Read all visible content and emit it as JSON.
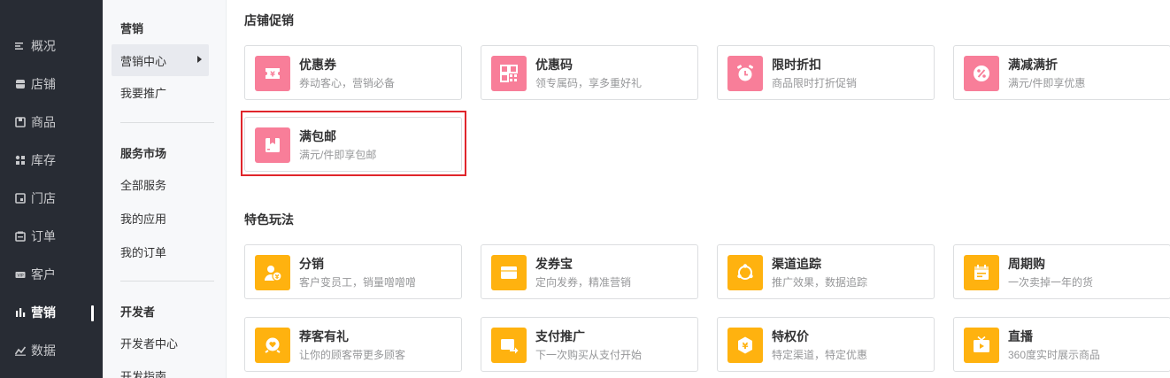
{
  "primary_nav": {
    "items": [
      {
        "label": "概况",
        "icon": "overview-icon"
      },
      {
        "label": "店铺",
        "icon": "store-icon"
      },
      {
        "label": "商品",
        "icon": "goods-icon"
      },
      {
        "label": "库存",
        "icon": "inventory-icon"
      },
      {
        "label": "门店",
        "icon": "shop-icon"
      },
      {
        "label": "订单",
        "icon": "order-icon"
      },
      {
        "label": "客户",
        "icon": "customer-icon"
      },
      {
        "label": "营销",
        "icon": "marketing-icon",
        "active": true
      },
      {
        "label": "数据",
        "icon": "data-icon"
      }
    ]
  },
  "sub_nav": {
    "groups": [
      {
        "title": "营销",
        "items": [
          {
            "label": "营销中心",
            "active": true
          },
          {
            "label": "我要推广"
          }
        ]
      },
      {
        "title": "服务市场",
        "items": [
          {
            "label": "全部服务"
          },
          {
            "label": "我的应用"
          },
          {
            "label": "我的订单"
          }
        ]
      },
      {
        "title": "开发者",
        "items": [
          {
            "label": "开发者中心"
          },
          {
            "label": "开发指南"
          }
        ]
      }
    ]
  },
  "sections": [
    {
      "title": "店铺促销",
      "cards": [
        {
          "title": "优惠券",
          "desc": "券动客心，营销必备",
          "icon": "coupon-icon",
          "color": "#f87e99"
        },
        {
          "title": "优惠码",
          "desc": "领专属码，享多重好礼",
          "icon": "qrcode-icon",
          "color": "#f87e99"
        },
        {
          "title": "限时折扣",
          "desc": "商品限时打折促销",
          "icon": "alarm-clock-icon",
          "color": "#f87e99"
        },
        {
          "title": "满减满折",
          "desc": "满元/件即享优惠",
          "icon": "percent-icon",
          "color": "#f87e99"
        },
        {
          "title": "满包邮",
          "desc": "满元/件即享包邮",
          "icon": "package-icon",
          "color": "#f87e99",
          "highlighted": true
        }
      ]
    },
    {
      "title": "特色玩法",
      "cards": [
        {
          "title": "分销",
          "desc": "客户变员工，销量噌噌噌",
          "icon": "distribution-icon",
          "color": "#ffb20f"
        },
        {
          "title": "发券宝",
          "desc": "定向发券，精准营销",
          "icon": "coupon-wallet-icon",
          "color": "#ffb20f"
        },
        {
          "title": "渠道追踪",
          "desc": "推广效果，数据追踪",
          "icon": "tracking-icon",
          "color": "#ffb20f"
        },
        {
          "title": "周期购",
          "desc": "一次卖掉一年的货",
          "icon": "calendar-icon",
          "color": "#ffb20f"
        },
        {
          "title": "荐客有礼",
          "desc": "让你的顾客带更多顾客",
          "icon": "referral-gift-icon",
          "color": "#ffb20f"
        },
        {
          "title": "支付推广",
          "desc": "下一次购买从支付开始",
          "icon": "payment-promotion-icon",
          "color": "#ffb20f"
        },
        {
          "title": "特权价",
          "desc": "特定渠道，特定优惠",
          "icon": "privilege-price-icon",
          "color": "#ffb20f"
        },
        {
          "title": "直播",
          "desc": "360度实时展示商品",
          "icon": "live-tv-icon",
          "color": "#ffb20f"
        }
      ]
    }
  ]
}
